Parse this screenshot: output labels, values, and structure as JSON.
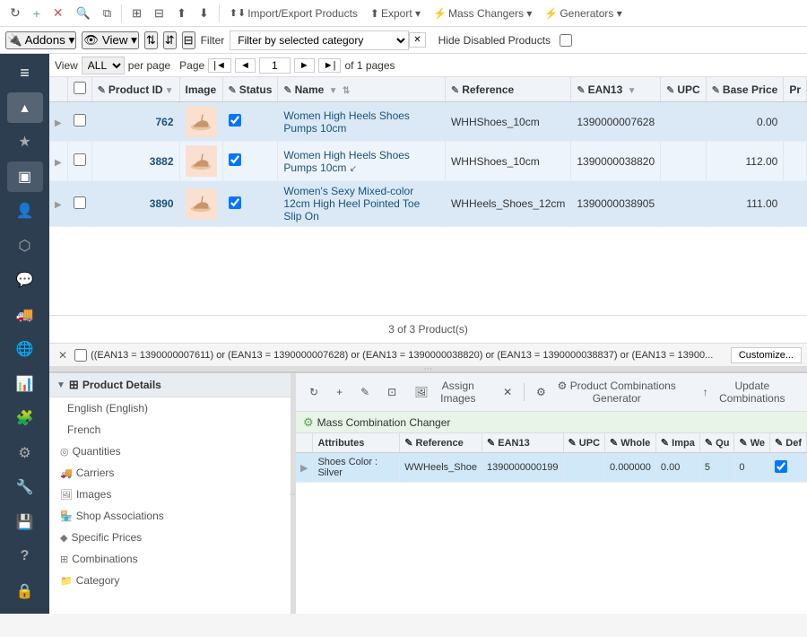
{
  "toolbar": {
    "buttons": [
      "refresh",
      "add",
      "delete-button",
      "search",
      "duplicate",
      "modules",
      "sql",
      "export-down",
      "export-up",
      "import-export",
      "export",
      "mass-changers",
      "generators"
    ],
    "import_export_label": "Import/Export Products",
    "export_label": "Export ▾",
    "mass_changers_label": "Mass Changers ▾",
    "generators_label": "Generators ▾"
  },
  "filter_toolbar": {
    "filter_label": "Filter",
    "addons_label": "Addons ▾",
    "view_label": "View ▾",
    "filter_value": "Filter by selected category",
    "hide_disabled_label": "Hide Disabled Products"
  },
  "pagination": {
    "view_label": "View",
    "all_option": "ALL",
    "per_page_label": "per page",
    "page_label": "Page",
    "page_number": "1",
    "of_pages": "of 1 pages"
  },
  "table": {
    "columns": [
      "",
      "",
      "Product ID",
      "Image",
      "Status",
      "Name",
      "Reference",
      "EAN13",
      "UPC",
      "Base Price",
      "Pr"
    ],
    "rows": [
      {
        "id": "762",
        "name": "Women High Heels Shoes Pumps 10cm",
        "reference": "WHHShoes_10cm",
        "ean13": "1390000007628",
        "upc": "",
        "base_price": "0.00",
        "status": true
      },
      {
        "id": "3882",
        "name": "Women High Heels Shoes Pumps 10cm",
        "reference": "WHHShoes_10cm",
        "ean13": "1390000038820",
        "upc": "",
        "base_price": "112.00",
        "status": true
      },
      {
        "id": "3890",
        "name": "Women's Sexy Mixed-color 12cm High Heel Pointed Toe Slip On",
        "reference": "WHHeels_Shoes_12cm",
        "ean13": "1390000038905",
        "upc": "",
        "base_price": "111.00",
        "status": true
      }
    ],
    "products_count": "3 of 3 Product(s)"
  },
  "filter_expression": "((EAN13 = 1390000007611) or (EAN13 = 1390000007628) or (EAN13 = 1390000038820) or (EAN13 = 1390000038837) or (EAN13 = 13900...",
  "customize_btn": "Customize...",
  "left_panel": {
    "header": "Product Details",
    "items": [
      {
        "label": "English (English)",
        "type": "lang"
      },
      {
        "label": "French",
        "type": "lang"
      },
      {
        "label": "Quantities",
        "type": "section",
        "icon": "◎"
      },
      {
        "label": "Carriers",
        "type": "section",
        "icon": "🚚"
      },
      {
        "label": "Images",
        "type": "section",
        "icon": "🖼"
      },
      {
        "label": "Shop Associations",
        "type": "section",
        "icon": "🏪"
      },
      {
        "label": "Specific Prices",
        "type": "section",
        "icon": "◆"
      },
      {
        "label": "Combinations",
        "type": "section",
        "icon": "⊞",
        "active": true
      },
      {
        "label": "Category",
        "type": "section",
        "icon": "📁"
      }
    ]
  },
  "right_panel": {
    "toolbar_buttons": [
      {
        "label": "↻",
        "name": "refresh-btn"
      },
      {
        "label": "+",
        "name": "add-btn"
      },
      {
        "label": "✎",
        "name": "edit-btn"
      },
      {
        "label": "⊡",
        "name": "duplicate-btn"
      },
      {
        "label": "Assign Images",
        "name": "assign-images-btn"
      },
      {
        "label": "✕",
        "name": "close-btn"
      },
      {
        "label": "⚙ Product Combinations Generator",
        "name": "combinations-generator-btn"
      },
      {
        "label": "↑ Update Combinations",
        "name": "update-combinations-btn"
      }
    ],
    "mass_combination_label": "Mass Combination Changer",
    "combinations_table": {
      "columns": [
        "",
        "Attributes",
        "Reference",
        "EAN13",
        "UPC",
        "Whole",
        "Impa",
        "Qu",
        "We",
        "Def"
      ],
      "rows": [
        {
          "attribute": "Shoes Color : Silver",
          "reference": "WWHeels_Shoe",
          "ean13": "1390000000199",
          "upc": "",
          "whole": "0.000000",
          "impa": "0.00",
          "qu": "5",
          "we": "0",
          "def": true
        }
      ]
    }
  },
  "nav_icons": [
    {
      "name": "hamburger-icon",
      "symbol": "≡",
      "active": false
    },
    {
      "name": "logo-icon",
      "symbol": "▲",
      "active": false
    },
    {
      "name": "star-icon",
      "symbol": "★",
      "active": false
    },
    {
      "name": "box-icon",
      "symbol": "▣",
      "active": true
    },
    {
      "name": "person-icon",
      "symbol": "👤",
      "active": false
    },
    {
      "name": "shield-icon",
      "symbol": "⬡",
      "active": false
    },
    {
      "name": "chat-icon",
      "symbol": "💬",
      "active": false
    },
    {
      "name": "truck-icon",
      "symbol": "🚚",
      "active": false
    },
    {
      "name": "globe-icon",
      "symbol": "🌐",
      "active": false
    },
    {
      "name": "chart-icon",
      "symbol": "📊",
      "active": false
    },
    {
      "name": "puzzle-icon",
      "symbol": "🧩",
      "active": false
    },
    {
      "name": "sliders-icon",
      "symbol": "⚙",
      "active": false
    },
    {
      "name": "wrench-icon",
      "symbol": "🔧",
      "active": false
    },
    {
      "name": "drive-icon",
      "symbol": "💾",
      "active": false
    },
    {
      "name": "question-icon",
      "symbol": "?",
      "active": false
    },
    {
      "name": "lock-icon",
      "symbol": "🔒",
      "active": false
    }
  ]
}
